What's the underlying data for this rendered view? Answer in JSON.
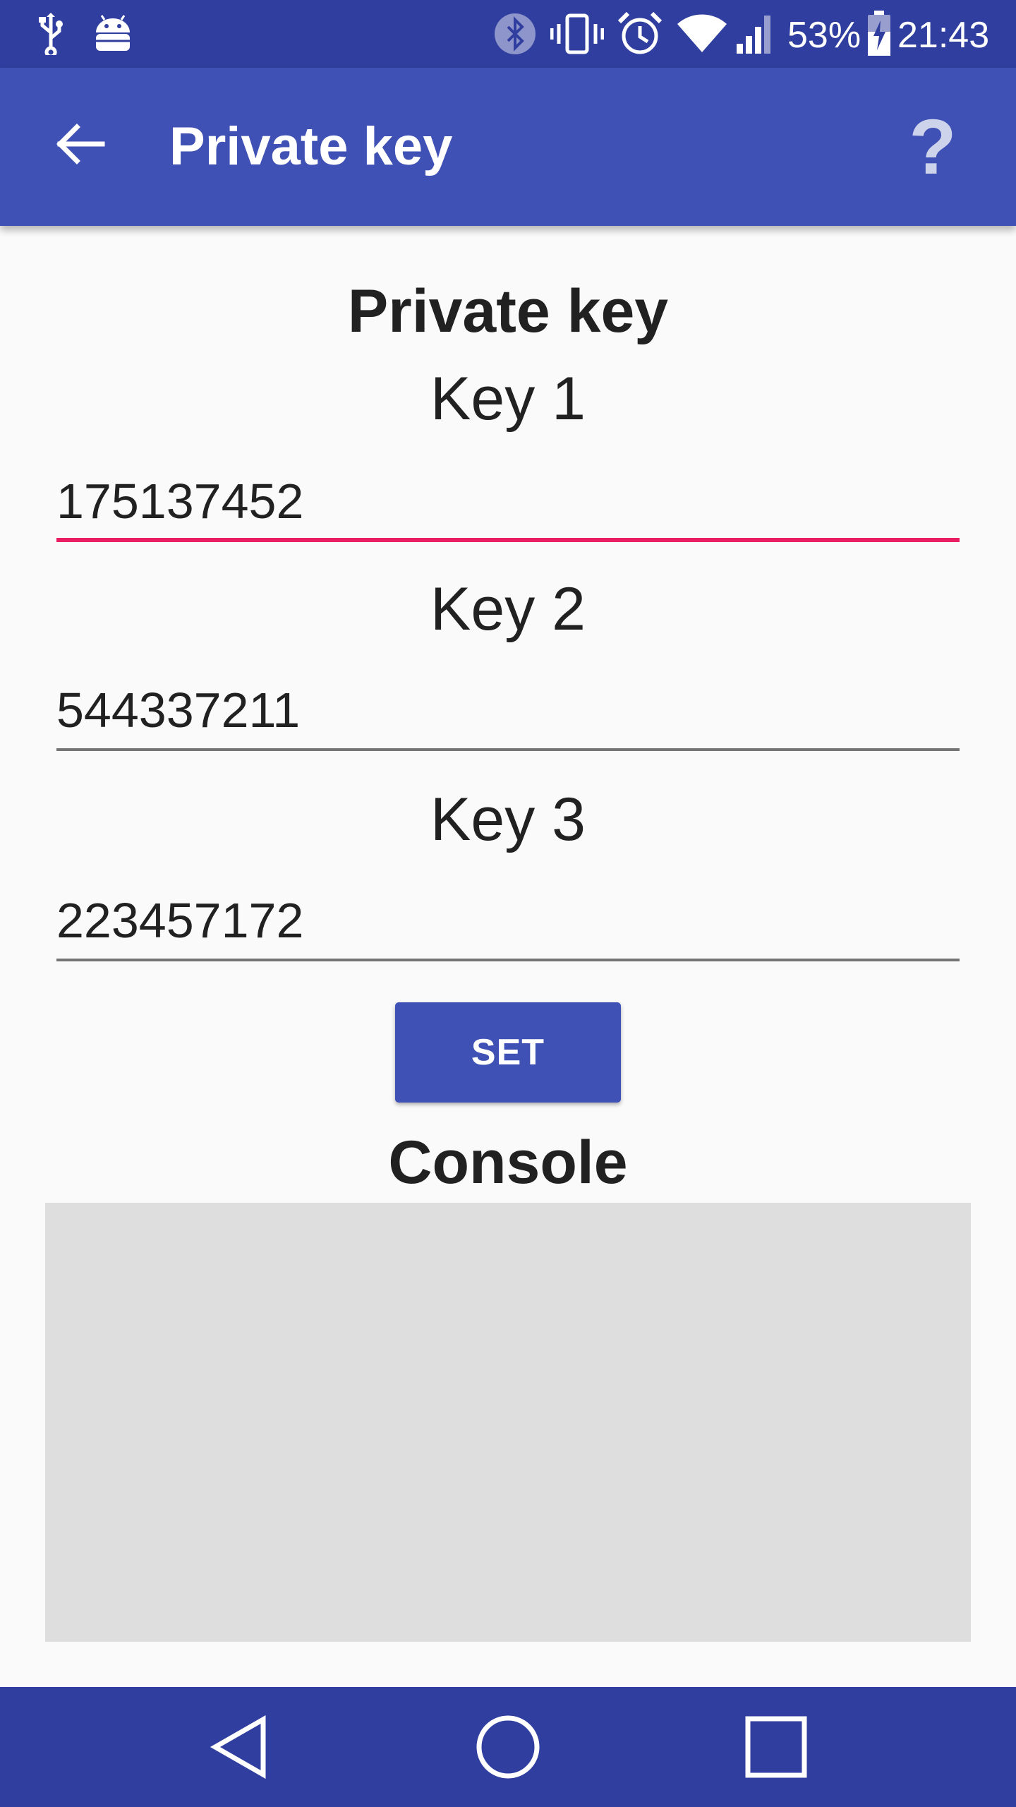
{
  "status_bar": {
    "battery_percent": "53%",
    "time": "21:43",
    "icons": [
      "usb-icon",
      "android-debug-icon",
      "bluetooth-icon",
      "vibrate-icon",
      "alarm-icon",
      "wifi-icon",
      "cell-signal-icon",
      "battery-charging-icon"
    ]
  },
  "app_bar": {
    "title": "Private key",
    "help_label": "?"
  },
  "main": {
    "heading": "Private key",
    "keys": [
      {
        "label": "Key 1",
        "value": "175137452"
      },
      {
        "label": "Key 2",
        "value": "544337211"
      },
      {
        "label": "Key 3",
        "value": "223457172"
      }
    ],
    "set_button": "SET",
    "console_heading": "Console",
    "console_text": ""
  },
  "colors": {
    "primary": "#3f51b5",
    "primary_dark": "#303f9f",
    "accent": "#e91e63",
    "console_bg": "#dedede"
  }
}
